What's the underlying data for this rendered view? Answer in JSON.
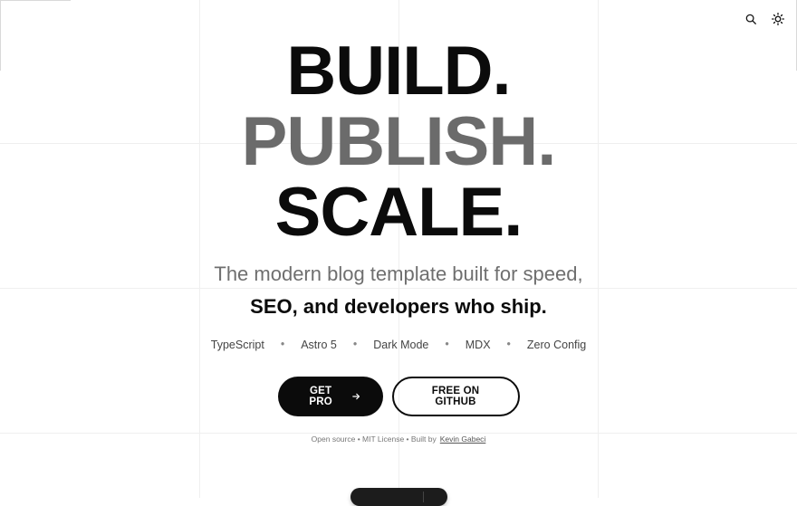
{
  "header": {
    "search_icon": "search-icon",
    "theme_icon": "sun-icon"
  },
  "hero": {
    "headline": {
      "line1": "BUILD.",
      "line2": "PUBLISH.",
      "line3": "SCALE."
    },
    "subtitle": {
      "line1": "The modern blog template built for speed,",
      "line2": "SEO, and developers who ship."
    },
    "tags": [
      "TypeScript",
      "Astro 5",
      "Dark Mode",
      "MDX",
      "Zero Config"
    ],
    "buttons": {
      "primary_label": "GET PRO",
      "secondary_label": "FREE ON GITHUB"
    },
    "note": {
      "prefix": "Open source • MIT License • Built by",
      "author": "Kevin Gabeci"
    }
  },
  "colors": {
    "text": "#0b0b0b",
    "muted": "#6b6b6b",
    "background": "#ffffff"
  }
}
